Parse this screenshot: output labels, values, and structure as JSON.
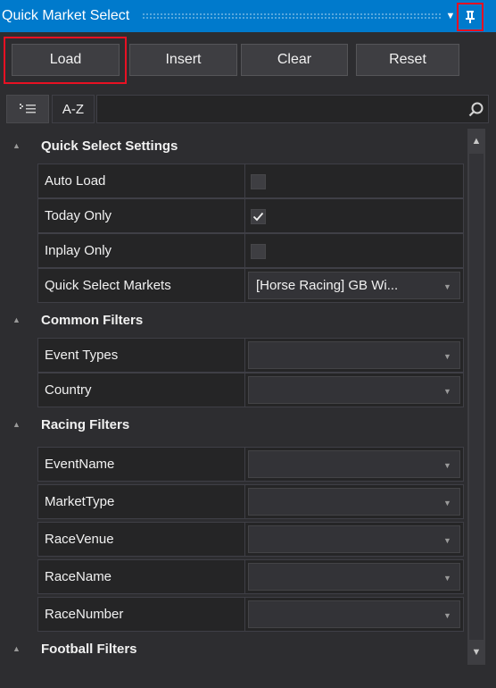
{
  "window": {
    "title": "Quick Market Select",
    "dropdown_icon": "triangle-down-icon",
    "pin_icon": "pin-icon"
  },
  "toolbar": {
    "load_label": "Load",
    "insert_label": "Insert",
    "clear_label": "Clear",
    "reset_label": "Reset"
  },
  "search": {
    "categorized_icon": "categorized-list-icon",
    "az_label": "A-Z",
    "value": "",
    "search_icon": "magnifier-icon"
  },
  "grid": {
    "categories": [
      {
        "label": "Quick Select Settings",
        "properties": [
          {
            "name": "Auto Load",
            "type": "checkbox",
            "checked": false
          },
          {
            "name": "Today Only",
            "type": "checkbox",
            "checked": true
          },
          {
            "name": "Inplay Only",
            "type": "checkbox",
            "checked": false
          },
          {
            "name": "Quick Select Markets",
            "type": "combo",
            "value": "[Horse Racing] GB Wi..."
          }
        ]
      },
      {
        "label": "Common Filters",
        "properties": [
          {
            "name": "Event Types",
            "type": "combo",
            "value": ""
          },
          {
            "name": "Country",
            "type": "combo",
            "value": ""
          }
        ]
      },
      {
        "label": "Racing Filters",
        "properties": [
          {
            "name": "EventName",
            "type": "combo",
            "value": ""
          },
          {
            "name": "MarketType",
            "type": "combo",
            "value": ""
          },
          {
            "name": "RaceVenue",
            "type": "combo",
            "value": ""
          },
          {
            "name": "RaceName",
            "type": "combo",
            "value": ""
          },
          {
            "name": "RaceNumber",
            "type": "combo",
            "value": ""
          }
        ]
      },
      {
        "label": "Football Filters",
        "properties": []
      }
    ]
  },
  "colors": {
    "accent": "#007acc",
    "highlight": "#e81123",
    "background": "#2d2d30",
    "cell": "#252526"
  }
}
